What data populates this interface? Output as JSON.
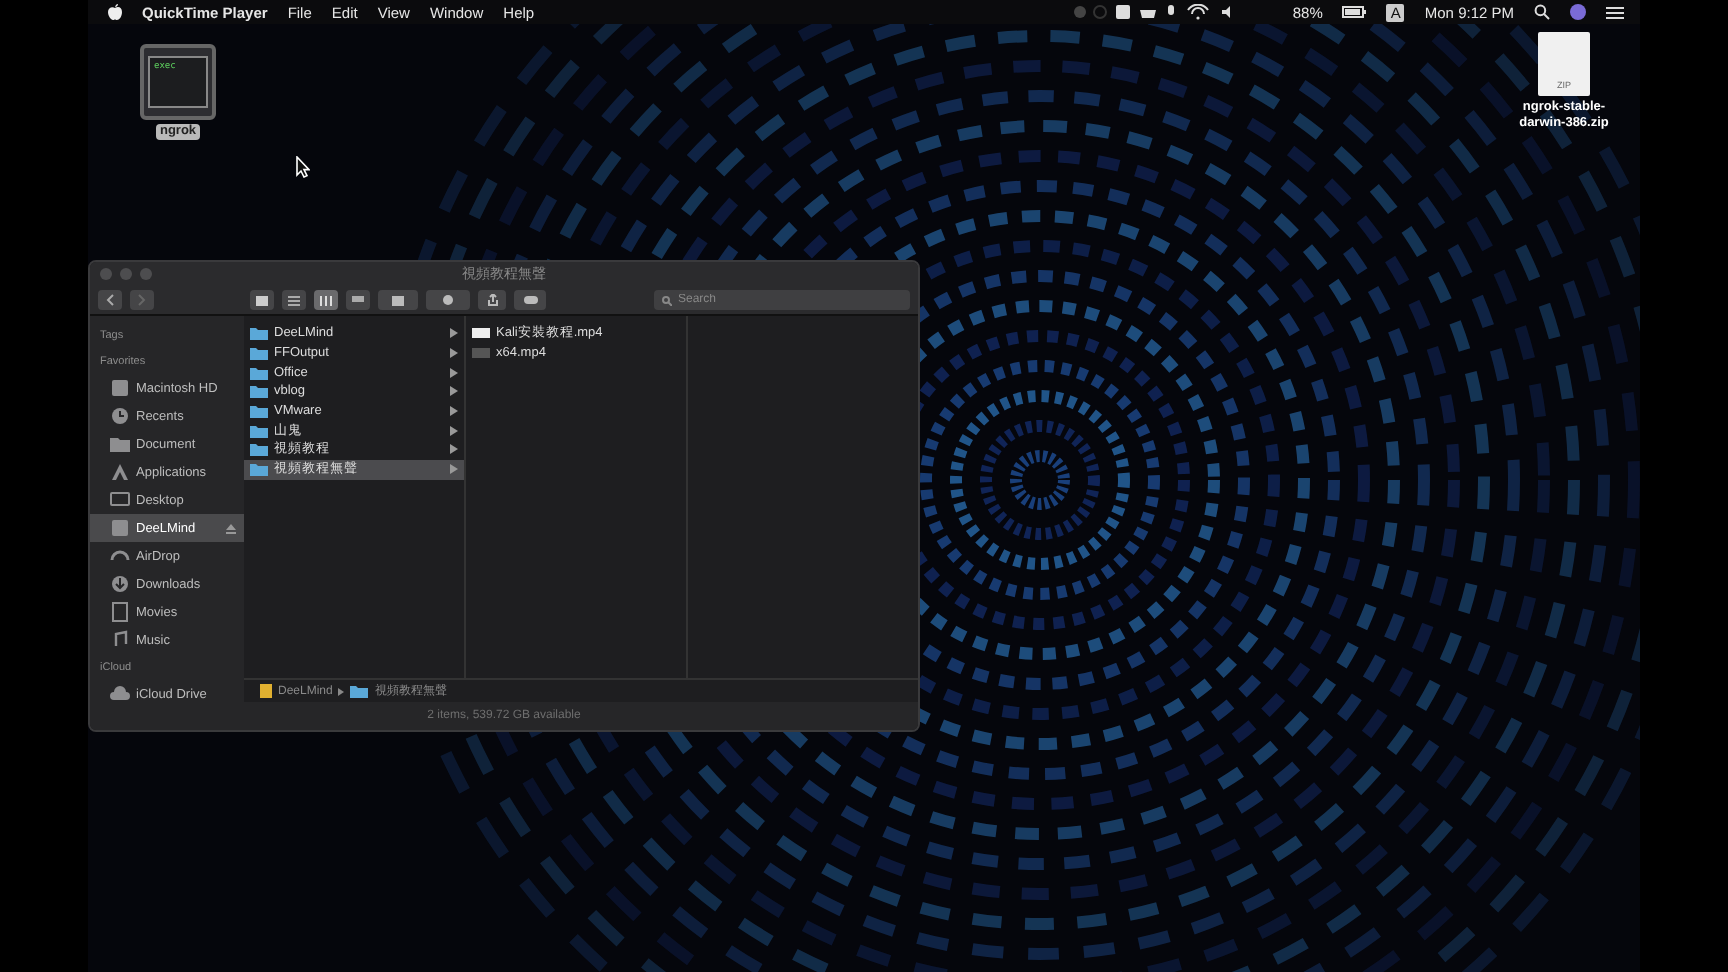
{
  "menu_bar": {
    "app": "QuickTime Player",
    "menus": [
      "File",
      "Edit",
      "View",
      "Window",
      "Help"
    ],
    "battery": "88%",
    "input_source": "A",
    "clock": "Mon 9:12 PM"
  },
  "desktop_icons": [
    {
      "kind": "exec",
      "icon_text": "exec",
      "label": "ngrok",
      "selected": true
    },
    {
      "kind": "zip",
      "icon_text": "ZIP",
      "label": "ngrok-stable-darwin-386.zip",
      "selected": false
    }
  ],
  "finder": {
    "title": "視頻教程無聲",
    "search": {
      "placeholder": "Search"
    },
    "sidebar": [
      {
        "heading": "Tags"
      },
      {
        "heading": "Favorites",
        "items": [
          {
            "label": "Macintosh HD",
            "selected": false,
            "ejectable": false
          },
          {
            "label": "Recents",
            "selected": false,
            "ejectable": false
          },
          {
            "label": "Document",
            "selected": false,
            "ejectable": false
          },
          {
            "label": "Applications",
            "selected": false,
            "ejectable": false
          },
          {
            "label": "Desktop",
            "selected": false,
            "ejectable": false
          },
          {
            "label": "DeeLMind",
            "selected": true,
            "ejectable": true
          },
          {
            "label": "AirDrop",
            "selected": false,
            "ejectable": false
          },
          {
            "label": "Downloads",
            "selected": false,
            "ejectable": false
          },
          {
            "label": "Movies",
            "selected": false,
            "ejectable": false
          },
          {
            "label": "Music",
            "selected": false,
            "ejectable": false
          }
        ]
      },
      {
        "heading": "iCloud",
        "items": [
          {
            "label": "iCloud Drive",
            "selected": false,
            "ejectable": false
          }
        ]
      }
    ],
    "column_1": [
      {
        "label": "DeeLMind",
        "selected": false
      },
      {
        "label": "FFOutput",
        "selected": false
      },
      {
        "label": "Office",
        "selected": false
      },
      {
        "label": "vblog",
        "selected": false
      },
      {
        "label": "VMware",
        "selected": false
      },
      {
        "label": "山鬼",
        "selected": false
      },
      {
        "label": "視頻教程",
        "selected": false
      },
      {
        "label": "視頻教程無聲",
        "selected": true
      }
    ],
    "column_2": [
      {
        "label": "Kali安裝教程.mp4",
        "selected": false
      },
      {
        "label": "x64.mp4",
        "selected": false
      }
    ],
    "path": [
      {
        "kind": "drive",
        "label": "DeeLMind"
      },
      {
        "kind": "folder",
        "label": "視頻教程無聲"
      }
    ],
    "status": "2 items, 539.72 GB available"
  }
}
